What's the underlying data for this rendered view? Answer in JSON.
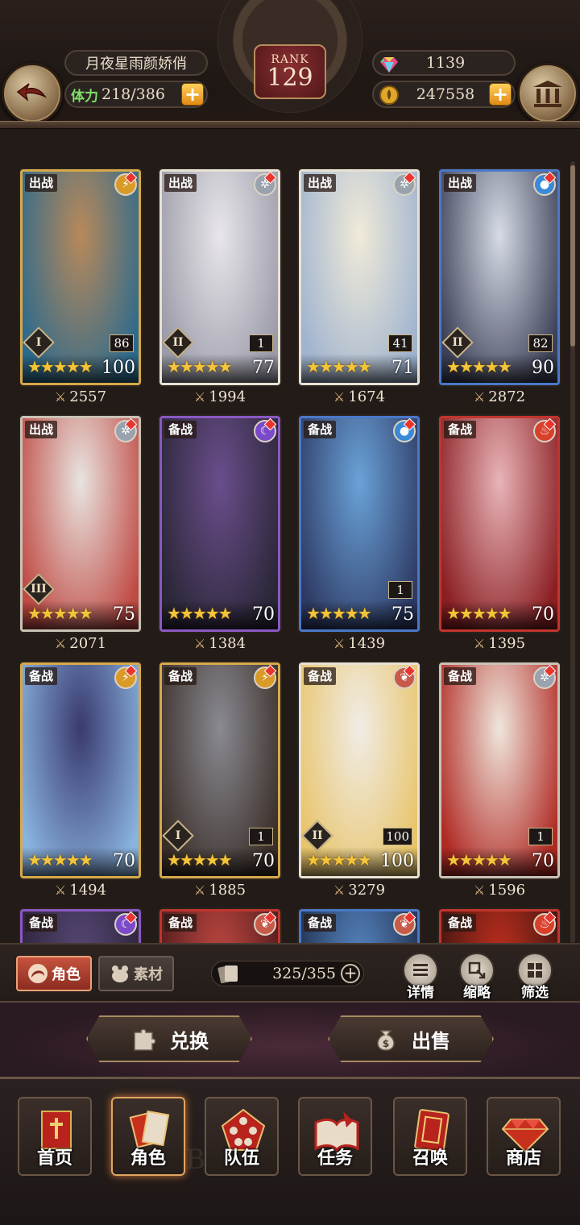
{
  "header": {
    "player_name": "月夜星雨颜娇俏",
    "stamina_label": "体力",
    "stamina_value": "218/386",
    "rank_label": "RANK",
    "rank_value": "129",
    "gems": "1139",
    "gold": "247558"
  },
  "cards": [
    {
      "status": "出战",
      "element": "lightning-icon",
      "level": "100",
      "grade": "I",
      "count": "86",
      "stars": 5,
      "power": "2557",
      "frame": "gold",
      "art": [
        "#b8895a",
        "#2c6a8d"
      ]
    },
    {
      "status": "出战",
      "element": "wind-icon",
      "level": "77",
      "grade": "II",
      "count": "1",
      "stars": 5,
      "power": "1994",
      "frame": "white",
      "art": [
        "#e8e6ea",
        "#9a9aa8"
      ]
    },
    {
      "status": "出战",
      "element": "wind-icon",
      "level": "71",
      "grade": "",
      "count": "41",
      "stars": 5,
      "power": "1674",
      "frame": "white",
      "art": [
        "#f0ead8",
        "#9fb3cf"
      ]
    },
    {
      "status": "出战",
      "element": "water-icon",
      "level": "90",
      "grade": "II",
      "count": "82",
      "stars": 5,
      "power": "2872",
      "frame": "blue",
      "art": [
        "#d6dbe6",
        "#3b3f56"
      ]
    },
    {
      "status": "出战",
      "element": "wind-icon",
      "level": "75",
      "grade": "III",
      "count": "",
      "stars": 5,
      "power": "2071",
      "frame": "silver",
      "art": [
        "#e8e4e0",
        "#c04a44"
      ]
    },
    {
      "status": "备战",
      "element": "moon-icon",
      "level": "70",
      "grade": "",
      "count": "",
      "stars": 5,
      "power": "1384",
      "frame": "purple",
      "art": [
        "#6a4e8c",
        "#2a2636"
      ]
    },
    {
      "status": "备战",
      "element": "water-icon",
      "level": "75",
      "grade": "",
      "count": "1",
      "stars": 5,
      "power": "1439",
      "frame": "blue",
      "art": [
        "#6aa2d8",
        "#2e3a64"
      ]
    },
    {
      "status": "备战",
      "element": "fire-icon",
      "level": "70",
      "grade": "",
      "count": "",
      "stars": 5,
      "power": "1395",
      "frame": "red",
      "art": [
        "#e8b4b8",
        "#8a1e22"
      ]
    },
    {
      "status": "备战",
      "element": "lightning-icon",
      "level": "70",
      "grade": "",
      "count": "",
      "stars": 5,
      "power": "1494",
      "frame": "gold",
      "art": [
        "#3a3a6e",
        "#8ab4e0"
      ]
    },
    {
      "status": "备战",
      "element": "lightning-icon",
      "level": "70",
      "grade": "I",
      "count": "1",
      "stars": 5,
      "power": "1885",
      "frame": "gold",
      "art": [
        "#8a8a92",
        "#3a2e28"
      ]
    },
    {
      "status": "备战",
      "element": "heart-icon",
      "level": "100",
      "grade": "II",
      "count": "100",
      "stars": 5,
      "power": "3279",
      "frame": "white",
      "art": [
        "#f0ece6",
        "#e8c46a"
      ]
    },
    {
      "status": "备战",
      "element": "wind-icon",
      "level": "70",
      "grade": "",
      "count": "1",
      "stars": 5,
      "power": "1596",
      "frame": "silver",
      "art": [
        "#efe6dc",
        "#b02a24"
      ]
    },
    {
      "status": "备战",
      "element": "moon-icon",
      "level": "",
      "grade": "",
      "count": "",
      "stars": 0,
      "power": "",
      "frame": "purple",
      "art": [
        "#5a4a7a",
        "#2a2236"
      ]
    },
    {
      "status": "备战",
      "element": "heart-icon",
      "level": "",
      "grade": "",
      "count": "",
      "stars": 0,
      "power": "",
      "frame": "red",
      "art": [
        "#c84a44",
        "#4a1a1a"
      ]
    },
    {
      "status": "备战",
      "element": "heart-icon",
      "level": "",
      "grade": "",
      "count": "",
      "stars": 0,
      "power": "",
      "frame": "blue",
      "art": [
        "#5a8ac8",
        "#1e2e4a"
      ]
    },
    {
      "status": "备战",
      "element": "fire-icon",
      "level": "",
      "grade": "",
      "count": "",
      "stars": 0,
      "power": "",
      "frame": "red",
      "art": [
        "#c8301e",
        "#3a1410"
      ]
    }
  ],
  "toolbar": {
    "tab_character": "角色",
    "tab_material": "素材",
    "capacity": "325/355",
    "details_label": "详情",
    "thumbnail_label": "缩略",
    "filter_label": "筛选"
  },
  "actions": {
    "exchange_label": "兑换",
    "sell_label": "出售"
  },
  "nav": {
    "home": "首页",
    "character": "角色",
    "team": "队伍",
    "quest": "任务",
    "summon": "召唤",
    "shop": "商店"
  },
  "colors": {
    "accent_gold": "#e08a14",
    "stamina_green": "#7ee06a",
    "active_tab_red": "#c6533e"
  }
}
